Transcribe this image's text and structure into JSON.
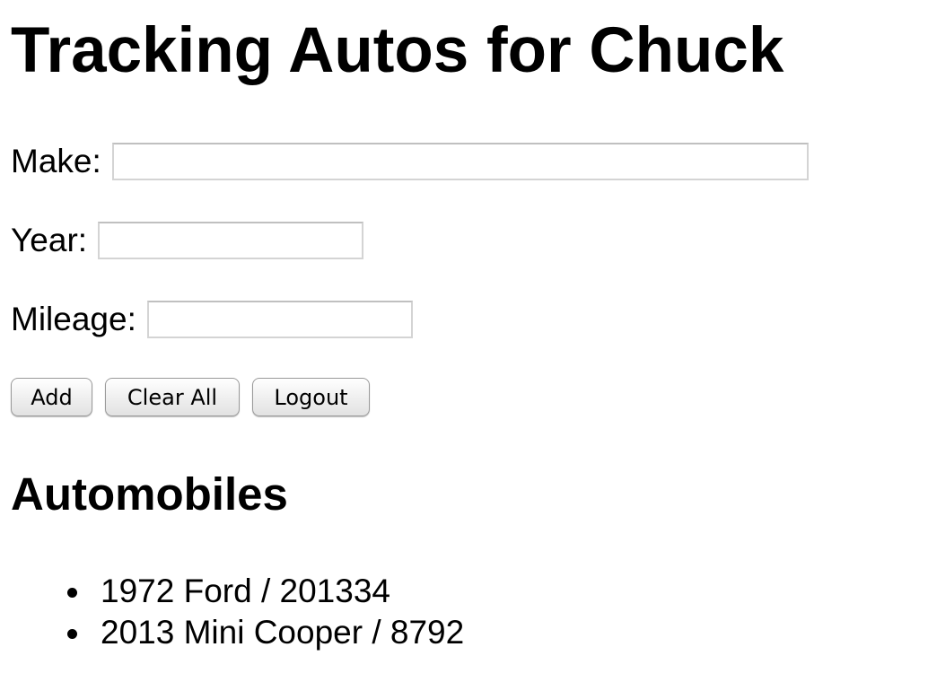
{
  "page": {
    "title": "Tracking Autos for Chuck"
  },
  "form": {
    "make": {
      "label": "Make:",
      "value": "",
      "placeholder": ""
    },
    "year": {
      "label": "Year:",
      "value": "",
      "placeholder": ""
    },
    "mileage": {
      "label": "Mileage:",
      "value": "",
      "placeholder": ""
    }
  },
  "buttons": {
    "add_label": "Add",
    "clear_label": "Clear All",
    "logout_label": "Logout"
  },
  "automobiles": {
    "heading": "Automobiles",
    "items": [
      {
        "text": "1972 Ford / 201334"
      },
      {
        "text": "2013 Mini Cooper / 8792"
      }
    ]
  }
}
